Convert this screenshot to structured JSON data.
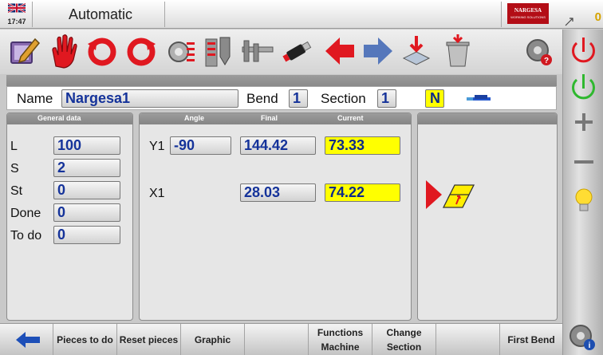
{
  "topbar": {
    "time": "17:47",
    "mode": "Automatic",
    "brand": "NARGESA",
    "brand_sub": "WORKING SOLUTIONS",
    "counter": "0"
  },
  "toolbar": {
    "icons": [
      "edit-icon",
      "stop-hand-icon",
      "rotate-left-icon",
      "rotate-right-icon",
      "program-lines-icon",
      "tooling-icon",
      "caliper-icon",
      "usb-icon",
      "arrow-left-icon",
      "arrow-right-icon",
      "download-icon",
      "trash-icon",
      "settings-help-icon",
      "power-red-icon"
    ]
  },
  "program": {
    "name_label": "Name",
    "name_value": "Nargesa1",
    "bend_label": "Bend",
    "bend_value": "1",
    "section_label": "Section",
    "section_value": "1",
    "n_badge": "N"
  },
  "general": {
    "header": "General data",
    "rows": [
      {
        "label": "L",
        "value": "100"
      },
      {
        "label": "S",
        "value": "2"
      },
      {
        "label": "St",
        "value": "0"
      },
      {
        "label": "Done",
        "value": "0"
      },
      {
        "label": "To do",
        "value": "0"
      }
    ]
  },
  "axes": {
    "headers": {
      "angle": "Angle",
      "final": "Final",
      "current": "Current"
    },
    "y1": {
      "label": "Y1",
      "angle": "-90",
      "final": "144.42",
      "current": "73.33"
    },
    "x1": {
      "label": "X1",
      "final": "28.03",
      "current": "74.22"
    }
  },
  "bottom": {
    "buttons": [
      {
        "id": "back",
        "label": ""
      },
      {
        "id": "pieces_to_do",
        "label": "Pieces to do"
      },
      {
        "id": "reset_pieces",
        "label": "Reset pieces"
      },
      {
        "id": "graphic",
        "label": "Graphic"
      },
      {
        "id": "empty1",
        "label": ""
      },
      {
        "id": "functions_machine",
        "line1": "Functions",
        "line2": "Machine"
      },
      {
        "id": "change_section",
        "line1": "Change",
        "line2": "Section"
      },
      {
        "id": "empty2",
        "label": ""
      },
      {
        "id": "first_bend",
        "label": "First Bend"
      }
    ]
  },
  "colors": {
    "accent_blue": "#15339a",
    "highlight_yellow": "#ffff00",
    "stop_red": "#e0141e",
    "go_green": "#2fb82f"
  }
}
